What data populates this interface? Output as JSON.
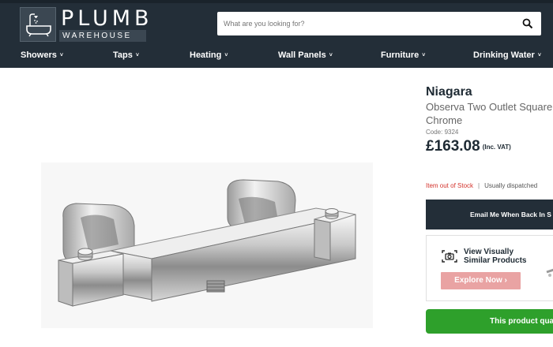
{
  "logo": {
    "word1": "PLUMB",
    "word2": "WAREHOUSE",
    "icon": "bathtub-shower-icon"
  },
  "search": {
    "placeholder": "What are you looking for?",
    "icon": "search-icon"
  },
  "nav": {
    "items": [
      {
        "label": "Showers"
      },
      {
        "label": "Taps"
      },
      {
        "label": "Heating"
      },
      {
        "label": "Wall Panels"
      },
      {
        "label": "Furniture"
      },
      {
        "label": "Drinking Water"
      }
    ],
    "chevron": "˅"
  },
  "product": {
    "brand": "Niagara",
    "name_line1": "Observa Two Outlet Square",
    "name_line2": "Chrome",
    "code": "Code: 9324",
    "price": "£163.08",
    "price_note": "(Inc. VAT)",
    "stock_status": "Item out of Stock",
    "stock_sep": "|",
    "dispatch": "Usually dispatched",
    "image": "thermostatic-shower-valve-image"
  },
  "actions": {
    "email_label": "Email Me When Back In S",
    "similar_title": "View Visually Similar Products",
    "explore_label": "Explore Now ›",
    "green_label": "This product qua"
  },
  "colors": {
    "header_bg": "#232e38",
    "out_of_stock": "#d3322b",
    "explore_bg": "#e9a3a3",
    "green": "#2ea02b"
  }
}
